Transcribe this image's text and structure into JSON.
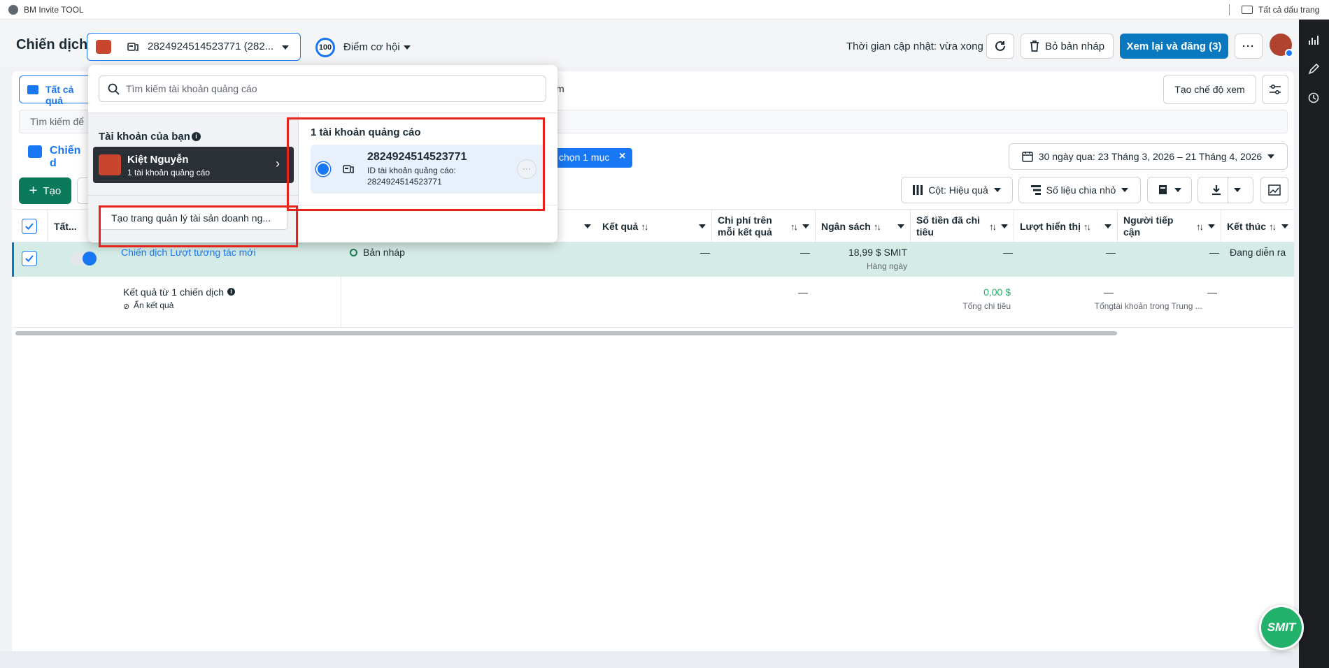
{
  "bookmarks": {
    "left": "BM Invite TOOL",
    "right": "Tất cả dấu trang"
  },
  "header": {
    "title": "Chiến dịch",
    "account_selector": "2824924514523771 (282...",
    "opportunity_score": "100",
    "opportunity_label": "Điểm cơ hội",
    "update_time": "Thời gian cập nhật: vừa xong",
    "discard_label": "Bỏ bản nháp",
    "publish_label": "Xem lại và đăng (3)"
  },
  "tabs": {
    "all": "Tất cả quả",
    "hidden_suffix": "m"
  },
  "toolbar": {
    "create_view": "Tạo chế độ xem",
    "search_placeholder": "Tìm kiếm để",
    "section_label": "Chiến d",
    "selected_badge": "chọn 1 mục",
    "date_range": "30 ngày qua: 23 Tháng 3, 2026 – 21 Tháng 4, 2026",
    "create_button": "Tạo",
    "columns_label": "Cột: Hiệu quả",
    "breakdown_label": "Số liệu chia nhỏ"
  },
  "table": {
    "headers": {
      "select_all": "Tất...",
      "results": "Kết quả",
      "cost_per_result": "Chi phí trên mỗi kết quả",
      "budget": "Ngân sách",
      "amount_spent": "Số tiền đã chi tiêu",
      "impressions": "Lượt hiển thị",
      "reach": "Người tiếp cận",
      "end": "Kết thúc"
    },
    "row": {
      "name": "Chiến dịch Lượt tương tác mới",
      "status": "Bản nháp",
      "results": "—",
      "cost_per_result": "—",
      "budget": "18,99 $ SMIT",
      "budget_sub": "Hàng ngày",
      "amount_spent": "—",
      "impressions": "—",
      "reach": "—",
      "end": "Đang diễn ra"
    },
    "summary": {
      "label": "Kết quả từ 1 chiến dịch",
      "hidden": "Ẩn kết quả",
      "cost_per_result": "—",
      "amount_spent": "0,00 $",
      "amount_spent_sub": "Tổng chi tiêu",
      "impressions": "—",
      "impressions_sub": "Tổng",
      "reach": "—",
      "reach_sub": "tài khoản trong Trung ..."
    }
  },
  "dropdown": {
    "search_placeholder": "Tìm kiếm tài khoản quảng cáo",
    "your_accounts": "Tài khoản của bạn",
    "user_name": "Kiệt Nguyễn",
    "user_sub": "1 tài khoản quảng cáo",
    "create_bm": "Tạo trang quản lý tài sản doanh ng...",
    "accounts_heading": "1 tài khoản quảng cáo",
    "account_id": "2824924514523771",
    "account_id_label": "ID tài khoản quảng cáo:",
    "account_id_value": "2824924514523771"
  },
  "fab_label": "SMIT",
  "colors": {
    "primary": "#0a78be",
    "highlight_row": "#d5ebe6",
    "red_box": "#e8221a",
    "fab": "#23b26b"
  }
}
